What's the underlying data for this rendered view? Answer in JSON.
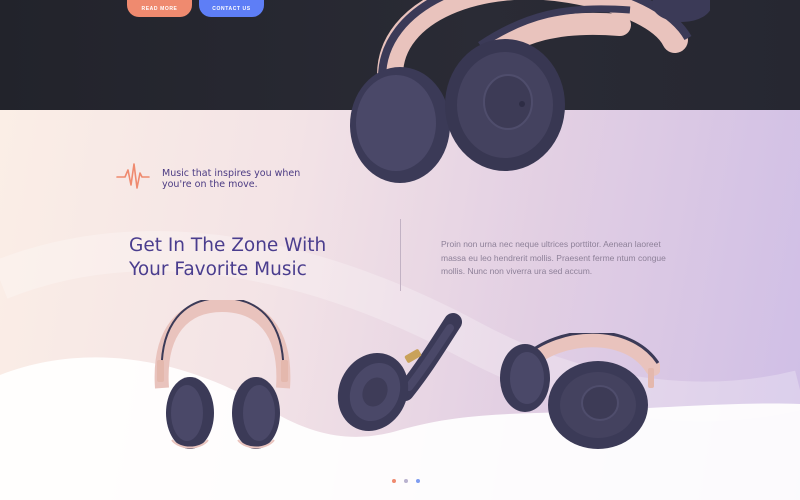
{
  "hero": {
    "read_more_label": "READ MORE",
    "contact_label": "CONTACT US"
  },
  "feature": {
    "tagline": "Music that inspires you when you're on the move.",
    "tagline_icon": "sound-pulse-icon",
    "headline": "Get In The Zone With Your Favorite Music",
    "body": "Proin non urna nec neque ultrices porttitor. Aenean laoreet massa eu leo hendrerit mollis. Praesent ferme ntum congue mollis. Nunc non viverra ura sed accum."
  },
  "products": [
    {
      "name": "headphones-front-view"
    },
    {
      "name": "headphones-folded-view"
    },
    {
      "name": "headphones-side-view"
    }
  ],
  "carousel": {
    "dot_colors": [
      "#ef8a6f",
      "#b9b2cf",
      "#7e9cf0"
    ],
    "active_index": 0
  },
  "colors": {
    "accent_orange": "#ef8a6f",
    "accent_blue": "#5e7ef6",
    "headline_purple": "#4a3d8e",
    "headphone_navy": "#3b3a57",
    "headphone_pink": "#e9c3bd"
  }
}
